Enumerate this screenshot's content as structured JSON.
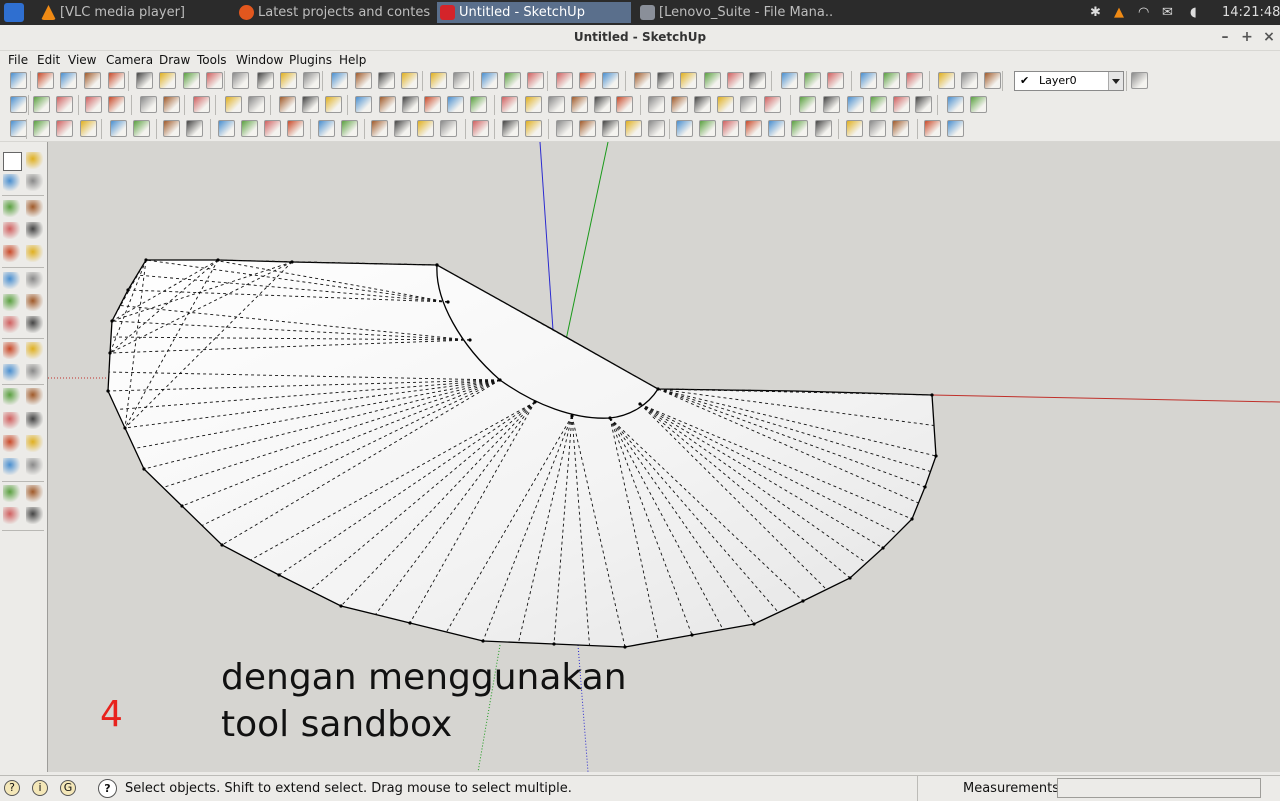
{
  "taskbar": {
    "tasks": [
      {
        "label": "[VLC media player]",
        "icon": "vlc-icon",
        "active": false
      },
      {
        "label": "Latest projects and contes...",
        "icon": "firefox-icon",
        "active": false
      },
      {
        "label": "Untitled - SketchUp",
        "icon": "sketchup-icon",
        "active": true
      },
      {
        "label": "[Lenovo_Suite - File Mana...",
        "icon": "folder-icon",
        "active": false
      }
    ],
    "clock": "14:21:48",
    "tray_icons": [
      "bluetooth-icon",
      "vlc-tray-icon",
      "wifi-icon",
      "mail-icon",
      "volume-icon"
    ]
  },
  "window": {
    "title": "Untitled - SketchUp",
    "controls": [
      "–",
      "+",
      "×"
    ]
  },
  "menu": [
    "File",
    "Edit",
    "View",
    "Camera",
    "Draw",
    "Tools",
    "Window",
    "Plugins",
    "Help"
  ],
  "layer": {
    "name": "Layer0",
    "checked": true
  },
  "annotation": {
    "number": "4",
    "line1": "dengan menggunakan",
    "line2": "tool sandbox",
    "number_color": "#e8221c"
  },
  "status": {
    "hint": "Select objects. Shift to extend select. Drag mouse to select multiple.",
    "measurements_label": "Measurements",
    "measurements_value": ""
  },
  "colors": {
    "viewport_bg": "#d6d5d1",
    "axis_red": "#c0302a",
    "axis_green": "#1a9a1a",
    "axis_blue": "#2b2bd0",
    "ui_bg": "#ecebe8"
  }
}
